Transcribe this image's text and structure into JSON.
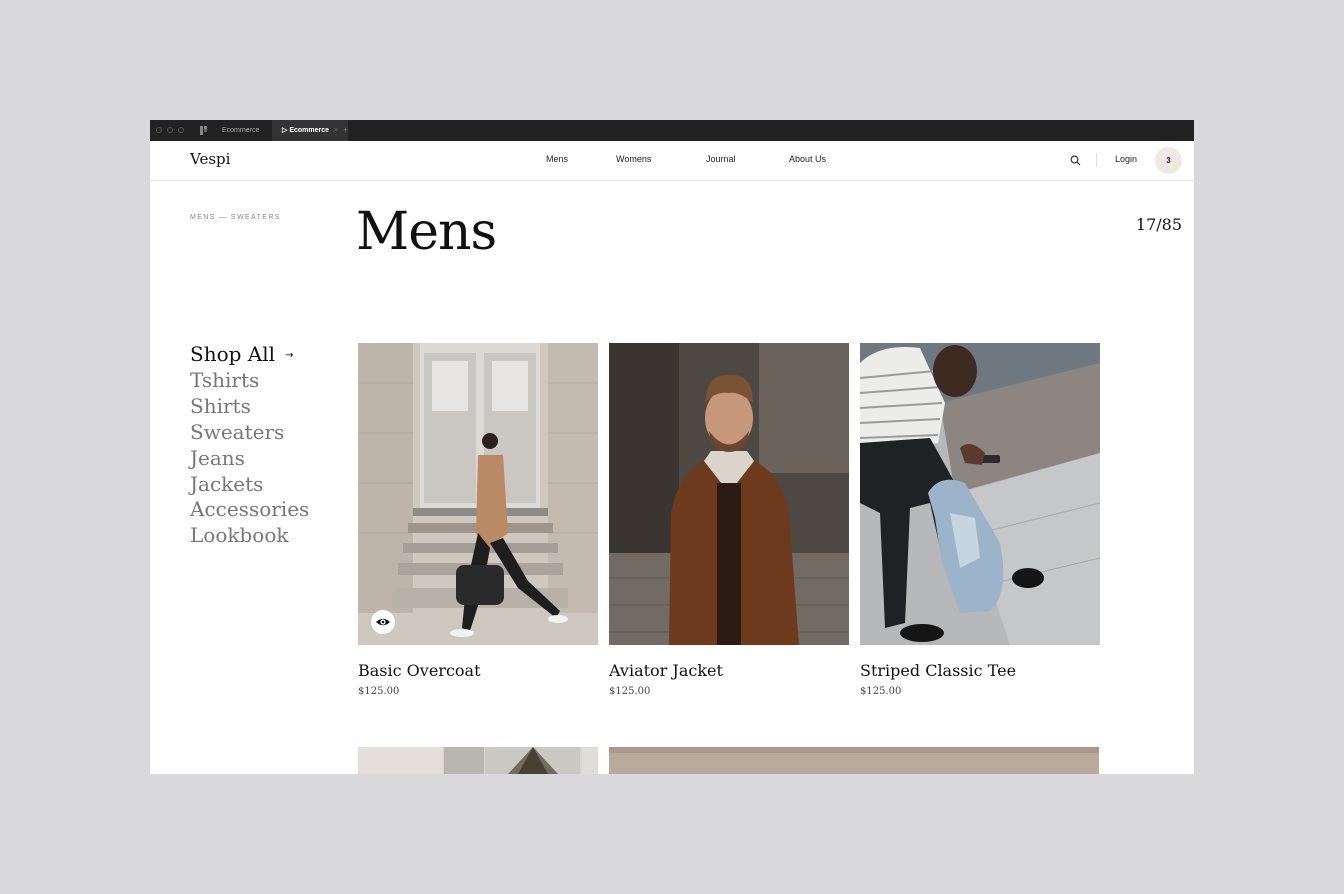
{
  "titlebar": {
    "tabs": [
      {
        "label": "Ecommerce"
      },
      {
        "label": "Ecommerce",
        "close": "×"
      }
    ],
    "plus": "+"
  },
  "nav": {
    "logo": "Vespi",
    "links": [
      "Mens",
      "Womens",
      "Journal",
      "About Us"
    ],
    "login": "Login",
    "cart_count": "3"
  },
  "breadcrumb": "MENS — SWEATERS",
  "page_title": "Mens",
  "counter": "17/85",
  "categories": [
    {
      "label": "Shop All",
      "arrow": "→"
    },
    {
      "label": "Tshirts"
    },
    {
      "label": "Shirts"
    },
    {
      "label": "Sweaters"
    },
    {
      "label": "Jeans"
    },
    {
      "label": "Jackets"
    },
    {
      "label": "Accessories"
    },
    {
      "label": "Lookbook"
    }
  ],
  "products": [
    {
      "name": "Basic Overcoat",
      "price": "$125.00"
    },
    {
      "name": "Aviator Jacket",
      "price": "$125.00"
    },
    {
      "name": "Striped Classic Tee",
      "price": "$125.00"
    }
  ],
  "colors": {
    "background": "#d9d9db",
    "titlebar": "#222222",
    "cart_badge": "#efe9df",
    "muted_text": "#777777"
  },
  "icons": {
    "search": "search-icon",
    "quickview": "eye-icon",
    "grid": "figma-icon"
  }
}
